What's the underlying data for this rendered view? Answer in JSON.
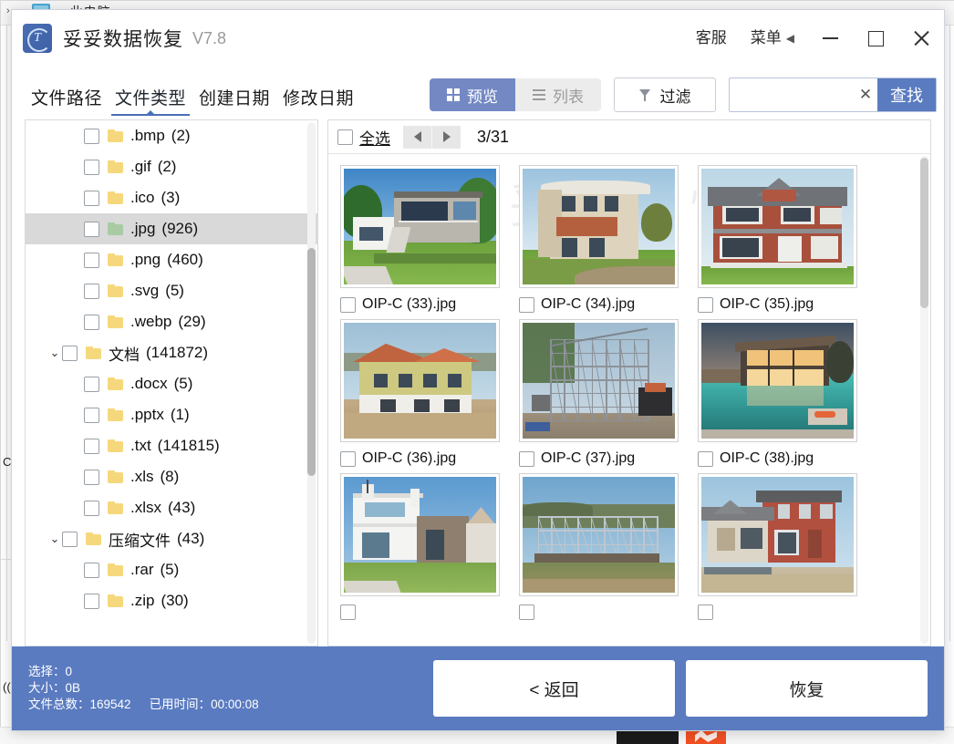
{
  "app": {
    "title": "妥妥数据恢复",
    "version": "V7.8",
    "logo_letter": "T",
    "titlebar": {
      "support_label": "客服",
      "menu_label": "菜单",
      "menu_caret": "◀",
      "minimize_icon": "minimize-icon",
      "maximize_icon": "maximize-icon",
      "close_icon": "close-icon"
    }
  },
  "tabs": [
    {
      "label": "文件路径",
      "active": false
    },
    {
      "label": "文件类型",
      "active": true
    },
    {
      "label": "创建日期",
      "active": false
    },
    {
      "label": "修改日期",
      "active": false
    }
  ],
  "toolbar": {
    "preview_label": "预览",
    "list_label": "列表",
    "filter_label": "过滤",
    "search_value": "",
    "search_placeholder": "",
    "clear_label": "✕",
    "find_label": "查找"
  },
  "tree": [
    {
      "indent": 1,
      "expander": "",
      "name": ".bmp",
      "count": "(2)",
      "selected": false,
      "folder": "yellow"
    },
    {
      "indent": 1,
      "expander": "",
      "name": ".gif",
      "count": "(2)",
      "selected": false,
      "folder": "yellow"
    },
    {
      "indent": 1,
      "expander": "",
      "name": ".ico",
      "count": "(3)",
      "selected": false,
      "folder": "yellow"
    },
    {
      "indent": 1,
      "expander": "",
      "name": ".jpg",
      "count": "(926)",
      "selected": true,
      "folder": "green"
    },
    {
      "indent": 1,
      "expander": "",
      "name": ".png",
      "count": "(460)",
      "selected": false,
      "folder": "yellow"
    },
    {
      "indent": 1,
      "expander": "",
      "name": ".svg",
      "count": "(5)",
      "selected": false,
      "folder": "yellow"
    },
    {
      "indent": 1,
      "expander": "",
      "name": ".webp",
      "count": "(29)",
      "selected": false,
      "folder": "yellow"
    },
    {
      "indent": 0,
      "expander": "⌄",
      "name": "文档",
      "count": "(141872)",
      "selected": false,
      "folder": "yellow"
    },
    {
      "indent": 1,
      "expander": "",
      "name": ".docx",
      "count": "(5)",
      "selected": false,
      "folder": "yellow"
    },
    {
      "indent": 1,
      "expander": "",
      "name": ".pptx",
      "count": "(1)",
      "selected": false,
      "folder": "yellow"
    },
    {
      "indent": 1,
      "expander": "",
      "name": ".txt",
      "count": "(141815)",
      "selected": false,
      "folder": "yellow"
    },
    {
      "indent": 1,
      "expander": "",
      "name": ".xls",
      "count": "(8)",
      "selected": false,
      "folder": "yellow"
    },
    {
      "indent": 1,
      "expander": "",
      "name": ".xlsx",
      "count": "(43)",
      "selected": false,
      "folder": "yellow"
    },
    {
      "indent": 0,
      "expander": "⌄",
      "name": "压缩文件",
      "count": "(43)",
      "selected": false,
      "folder": "yellow"
    },
    {
      "indent": 1,
      "expander": "",
      "name": ".rar",
      "count": "(5)",
      "selected": false,
      "folder": "yellow"
    },
    {
      "indent": 1,
      "expander": "",
      "name": ".zip",
      "count": "(30)",
      "selected": false,
      "folder": "yellow"
    }
  ],
  "preview": {
    "select_all_label": "全选",
    "prev_icon": "arrow-left-icon",
    "next_icon": "arrow-right-icon",
    "page_indicator": "3/31",
    "watermark": "妥妥数据恢复",
    "files": [
      {
        "name": "OIP-C (33).jpg",
        "art": "modern-white-house"
      },
      {
        "name": "OIP-C (34).jpg",
        "art": "cream-villa"
      },
      {
        "name": "OIP-C (35).jpg",
        "art": "red-brick-house"
      },
      {
        "name": "OIP-C (36).jpg",
        "art": "yellow-house-construction"
      },
      {
        "name": "OIP-C (37).jpg",
        "art": "steel-frame-tall"
      },
      {
        "name": "OIP-C (38).jpg",
        "art": "pool-house-sunset"
      },
      {
        "name": "",
        "art": "white-stone-house"
      },
      {
        "name": "",
        "art": "steel-frame-wide"
      },
      {
        "name": "",
        "art": "red-wood-house"
      }
    ]
  },
  "footer": {
    "selected_label": "选择：",
    "selected_value": "0",
    "size_label": "大小：",
    "size_value": "0B",
    "total_label": "文件总数：",
    "total_value": "169542",
    "elapsed_label": "已用时间：",
    "elapsed_value": "00:00:08",
    "back_label": "< 返回",
    "recover_label": "恢复"
  },
  "background": {
    "breadcrumb_left": "›",
    "breadcrumb_item": "此电脑",
    "breadcrumb_right": "›",
    "stray_c": "C",
    "stray_paren": "(("
  },
  "colors": {
    "accent_blue": "#5a7bc0",
    "segment_blue": "#7489c4",
    "tab_underline": "#4a6fb5",
    "folder_yellow": "#f6d87c",
    "folder_green": "#a9cba4",
    "selected_row": "#d9d9d9"
  }
}
